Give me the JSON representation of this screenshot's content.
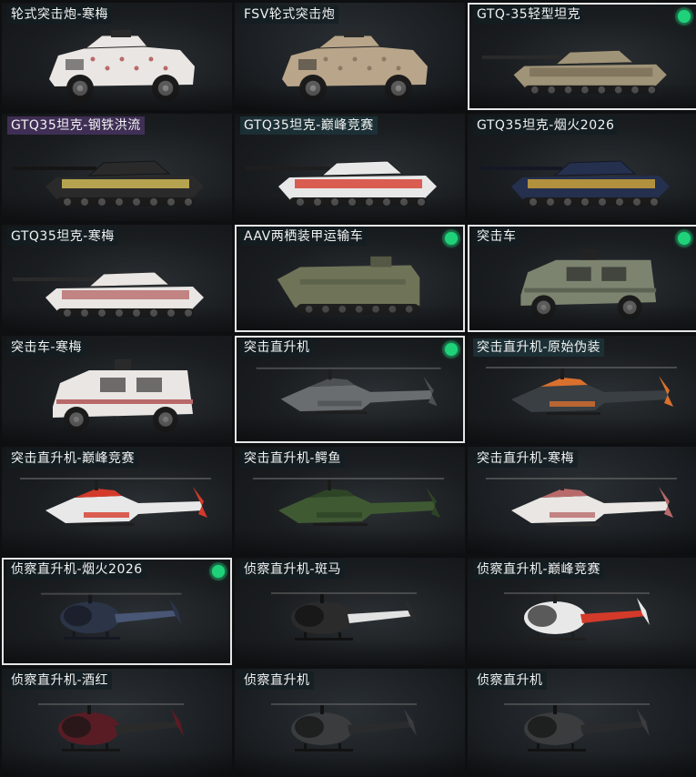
{
  "grid": {
    "items": [
      {
        "label": "轮式突击炮-寒梅",
        "kind": "wheeled-gun",
        "scheme": "white-camo",
        "equipped": false,
        "selected": false
      },
      {
        "label": "FSV轮式突击炮",
        "kind": "wheeled-gun",
        "scheme": "tan",
        "equipped": false,
        "selected": false
      },
      {
        "label": "GTQ-35轻型坦克",
        "kind": "tank",
        "scheme": "desert",
        "equipped": true,
        "selected": true
      },
      {
        "label": "GTQ35坦克-钢铁洪流",
        "kind": "tank",
        "scheme": "black-yellow",
        "equipped": false,
        "selected": false
      },
      {
        "label": "GTQ35坦克-巅峰竞赛",
        "kind": "tank",
        "scheme": "red-white",
        "equipped": false,
        "selected": false
      },
      {
        "label": "GTQ35坦克-烟火2026",
        "kind": "tank",
        "scheme": "navy-fireworks",
        "equipped": false,
        "selected": false
      },
      {
        "label": "GTQ35坦克-寒梅",
        "kind": "tank",
        "scheme": "white-camo",
        "equipped": false,
        "selected": false
      },
      {
        "label": "AAV两栖装甲运输车",
        "kind": "amphibious",
        "scheme": "olive",
        "equipped": true,
        "selected": true
      },
      {
        "label": "突击车",
        "kind": "mrap",
        "scheme": "grey-green",
        "equipped": true,
        "selected": true
      },
      {
        "label": "突击车-寒梅",
        "kind": "mrap",
        "scheme": "white-camo",
        "equipped": false,
        "selected": false
      },
      {
        "label": "突击直升机",
        "kind": "attack-heli",
        "scheme": "grey",
        "equipped": true,
        "selected": true
      },
      {
        "label": "突击直升机-原始伪装",
        "kind": "attack-heli",
        "scheme": "orange-camo",
        "equipped": false,
        "selected": false
      },
      {
        "label": "突击直升机-巅峰竞赛",
        "kind": "attack-heli",
        "scheme": "red-white",
        "equipped": false,
        "selected": false
      },
      {
        "label": "突击直升机-鳄鱼",
        "kind": "attack-heli",
        "scheme": "green",
        "equipped": false,
        "selected": false
      },
      {
        "label": "突击直升机-寒梅",
        "kind": "attack-heli",
        "scheme": "white-camo",
        "equipped": false,
        "selected": false
      },
      {
        "label": "侦察直升机-烟火2026",
        "kind": "scout-heli",
        "scheme": "navy",
        "equipped": true,
        "selected": true
      },
      {
        "label": "侦察直升机-斑马",
        "kind": "scout-heli",
        "scheme": "zebra",
        "equipped": false,
        "selected": false
      },
      {
        "label": "侦察直升机-巅峰竞赛",
        "kind": "scout-heli",
        "scheme": "red-white",
        "equipped": false,
        "selected": false
      },
      {
        "label": "侦察直升机-酒红",
        "kind": "scout-heli",
        "scheme": "wine",
        "equipped": false,
        "selected": false
      },
      {
        "label": "侦察直升机",
        "kind": "scout-heli",
        "scheme": "black",
        "equipped": false,
        "selected": false
      },
      {
        "label": "侦察直升机",
        "kind": "scout-heli",
        "scheme": "black",
        "equipped": false,
        "selected": false
      }
    ]
  },
  "colors": {
    "equipped_indicator": "#1fd27a",
    "selected_border": "#e6e6e6",
    "label_bg": "#1c343a",
    "label_bg_purple": "#46325f"
  },
  "schemes": {
    "white-camo": {
      "body": "#e9e6e3",
      "accent": "#b86a6a",
      "dark": "#2a2a2a"
    },
    "tan": {
      "body": "#b9a58a",
      "accent": "#8c7a63",
      "dark": "#2a2a2a"
    },
    "desert": {
      "body": "#a09478",
      "accent": "#7a6f58",
      "dark": "#2a2a2a"
    },
    "black-yellow": {
      "body": "#2a2a2a",
      "accent": "#d8c25a",
      "dark": "#151515"
    },
    "red-white": {
      "body": "#e8e8e8",
      "accent": "#d43a2a",
      "dark": "#1e1e1e"
    },
    "navy-fireworks": {
      "body": "#25304f",
      "accent": "#d4aa3a",
      "dark": "#141824"
    },
    "olive": {
      "body": "#6f7358",
      "accent": "#545844",
      "dark": "#262620"
    },
    "grey-green": {
      "body": "#7c836f",
      "accent": "#5d6352",
      "dark": "#232323"
    },
    "grey": {
      "body": "#6a6d70",
      "accent": "#4e5154",
      "dark": "#1f1f1f"
    },
    "orange-camo": {
      "body": "#3a3f44",
      "accent": "#d9702e",
      "dark": "#1b1b1b"
    },
    "green": {
      "body": "#3f5a33",
      "accent": "#2e4426",
      "dark": "#1b1b1b"
    },
    "navy": {
      "body": "#2c3448",
      "accent": "#495675",
      "dark": "#151821"
    },
    "zebra": {
      "body": "#2b2b2b",
      "accent": "#e2e2e2",
      "dark": "#111111"
    },
    "wine": {
      "body": "#5a1c24",
      "accent": "#2a2a2a",
      "dark": "#151515"
    },
    "black": {
      "body": "#3a3c3e",
      "accent": "#2a2b2c",
      "dark": "#121212"
    }
  }
}
